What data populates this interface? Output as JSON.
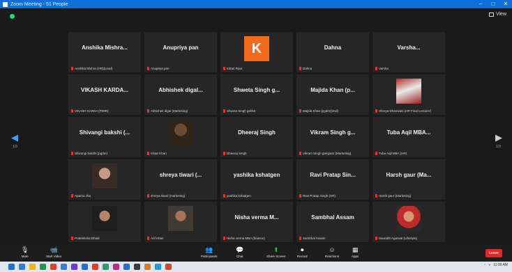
{
  "window": {
    "title": "Zoom Meeting - 51 People"
  },
  "view_label": "View",
  "participants": [
    {
      "name": "Anshika Mishra...",
      "label": "Anshika Mishra (HR)(Lead)",
      "avatar": "none"
    },
    {
      "name": "Anupriya pan",
      "label": "Anupriya pan",
      "avatar": "none"
    },
    {
      "name": "",
      "label": "Kittan Raut",
      "avatar": "letter",
      "letter": "K"
    },
    {
      "name": "Dahna",
      "label": "Dahna",
      "avatar": "none"
    },
    {
      "name": "Varsha...",
      "label": "Varsha",
      "avatar": "none"
    },
    {
      "name": "VIKASH KARDA...",
      "label": "VIKASH KARDA (PIMR)",
      "avatar": "none"
    },
    {
      "name": "Abhishek digal...",
      "label": "Abhishek digal (Marketing)",
      "avatar": "none"
    },
    {
      "name": "Shweta Singh g...",
      "label": "Shweta Singh gehlot",
      "avatar": "none"
    },
    {
      "name": "Majida Khan (p...",
      "label": "Majida Khan (pgdm)(2nd)",
      "avatar": "none"
    },
    {
      "name": "",
      "label": "Shreya Dhanwani (HR Final Lecturer)",
      "avatar": "photo1"
    },
    {
      "name": "Shivangi bakshi (...",
      "label": "Shivangi bakshi (pgdm)",
      "avatar": "none"
    },
    {
      "name": "",
      "label": "Ishan Khan",
      "avatar": "photo2"
    },
    {
      "name": "Dheeraj Singh",
      "label": "Dheeraj Singh",
      "avatar": "none"
    },
    {
      "name": "Vikram Singh g...",
      "label": "Vikram Singh gangwar (Marketing)",
      "avatar": "none"
    },
    {
      "name": "Tuba Aqil MBA...",
      "label": "Tuba Aqil MBA (HR)",
      "avatar": "none"
    },
    {
      "name": "",
      "label": "Aparna Jha",
      "avatar": "photo3"
    },
    {
      "name": "shreya tiwari (...",
      "label": "shreya tiwari (marketing)",
      "avatar": "none"
    },
    {
      "name": "yashika kshatgen",
      "label": "yashika kshatgen",
      "avatar": "none"
    },
    {
      "name": "Ravi Pratap Sin...",
      "label": "Ravi Pratap Singh (HR)",
      "avatar": "none"
    },
    {
      "name": "Harsh gaur (Ma...",
      "label": "Harsh gaur (Marketing)",
      "avatar": "none"
    },
    {
      "name": "",
      "label": "Prateeksha Bhadi",
      "avatar": "photo4"
    },
    {
      "name": "",
      "label": "Arif Khan",
      "avatar": "photo5"
    },
    {
      "name": "Nisha verma M...",
      "label": "Nisha verma MBA (finance)",
      "avatar": "none"
    },
    {
      "name": "Sambhal Assam",
      "label": "Sambhal Assam",
      "avatar": "none"
    },
    {
      "name": "",
      "label": "Saurabh Agarwal (Lifestyle)",
      "avatar": "photo6"
    }
  ],
  "pagination": {
    "left": "1/3",
    "right": "1/3"
  },
  "controls": [
    {
      "id": "mute",
      "label": "Mute",
      "icon": "🎙"
    },
    {
      "id": "video",
      "label": "Start Video",
      "icon": "📹"
    },
    {
      "id": "participants",
      "label": "Participants",
      "icon": "👥"
    },
    {
      "id": "chat",
      "label": "Chat",
      "icon": "💬"
    },
    {
      "id": "share",
      "label": "Share Screen",
      "icon": "⬆"
    },
    {
      "id": "record",
      "label": "Record",
      "icon": "⏺"
    },
    {
      "id": "reactions",
      "label": "Reactions",
      "icon": "☺"
    },
    {
      "id": "apps",
      "label": "Apps",
      "icon": "▦"
    }
  ],
  "end_label": "Leave",
  "taskbar": {
    "time": "11:09 AM"
  },
  "colors": {
    "accent": "#0e6fd8",
    "tile": "#262626",
    "end": "#e02828",
    "green": "#25c05a"
  }
}
